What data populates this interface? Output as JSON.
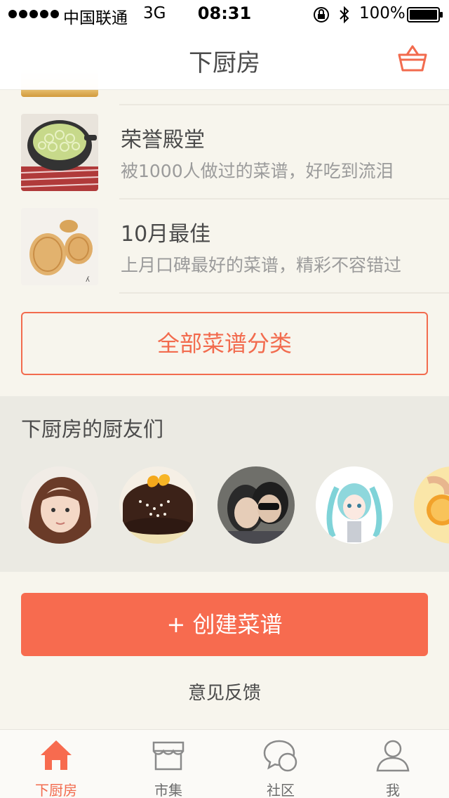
{
  "status_bar": {
    "carrier": "中国联通",
    "network": "3G",
    "time": "08:31",
    "battery": "100%"
  },
  "nav": {
    "title": "下厨房",
    "cart_icon": "basket-icon"
  },
  "list_items": [
    {
      "title": "荣誉殿堂",
      "subtitle": "被1000人做过的菜谱，好吃到流泪"
    },
    {
      "title": "10月最佳",
      "subtitle": "上月口碑最好的菜谱，精彩不容错过"
    }
  ],
  "all_categories_label": "全部菜谱分类",
  "friends": {
    "heading": "下厨房的厨友们"
  },
  "create_label": "+ 创建菜谱",
  "feedback_label": "意见反馈",
  "tabs": [
    {
      "label": "下厨房",
      "icon": "home-icon",
      "active": true
    },
    {
      "label": "市集",
      "icon": "shop-icon",
      "active": false
    },
    {
      "label": "社区",
      "icon": "chat-icon",
      "active": false
    },
    {
      "label": "我",
      "icon": "person-icon",
      "active": false
    }
  ],
  "colors": {
    "accent": "#f76b4f",
    "background": "#f7f5ed",
    "section_bg": "#ebeae3"
  }
}
